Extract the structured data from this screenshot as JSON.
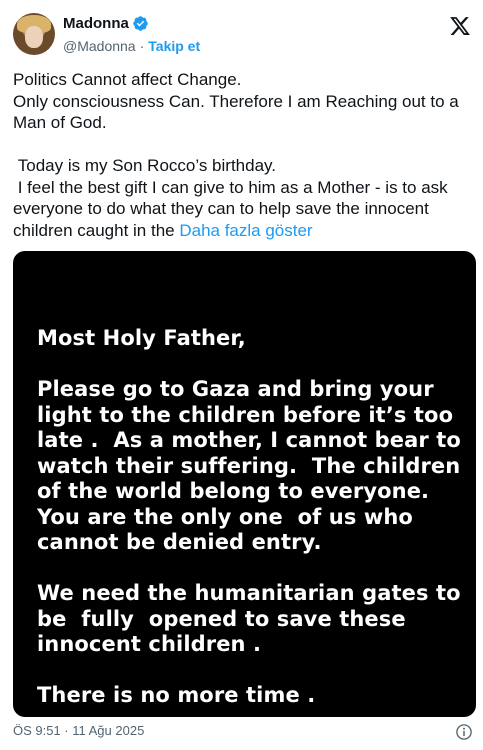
{
  "author": {
    "name": "Madonna",
    "handle": "@Madonna",
    "separator": "·",
    "follow_label": "Takip et"
  },
  "tweet": {
    "text": "Politics Cannot affect Change.\nOnly consciousness Can. Therefore I am Reaching out to a Man of God.\n\n Today is my Son Rocco’s birthday.\n I feel the best gift I can give to him as a Mother - is to ask everyone to do what they can to help save the innocent children caught in the ",
    "show_more_label": "Daha fazla göster"
  },
  "media": {
    "text": "Most Holy Father,\n\nPlease go to Gaza and bring your light to the children before it’s too late .  As a mother, I cannot bear to watch their suffering.  The children of the world belong to everyone.\nYou are the only one  of us who cannot be denied entry.\n\nWe need the humanitarian gates to be  fully  opened to save these innocent children .\n\nThere is no more time ."
  },
  "footer": {
    "timestamp": "ÖS 9:51 · 11 Ağu 2025"
  },
  "icons": {
    "verified": "verified-badge-icon",
    "logo": "x-logo-icon",
    "info": "info-icon"
  },
  "colors": {
    "accent": "#1d9bf0",
    "text": "#0f1419",
    "secondary": "#536471",
    "media_bg": "#000000"
  }
}
